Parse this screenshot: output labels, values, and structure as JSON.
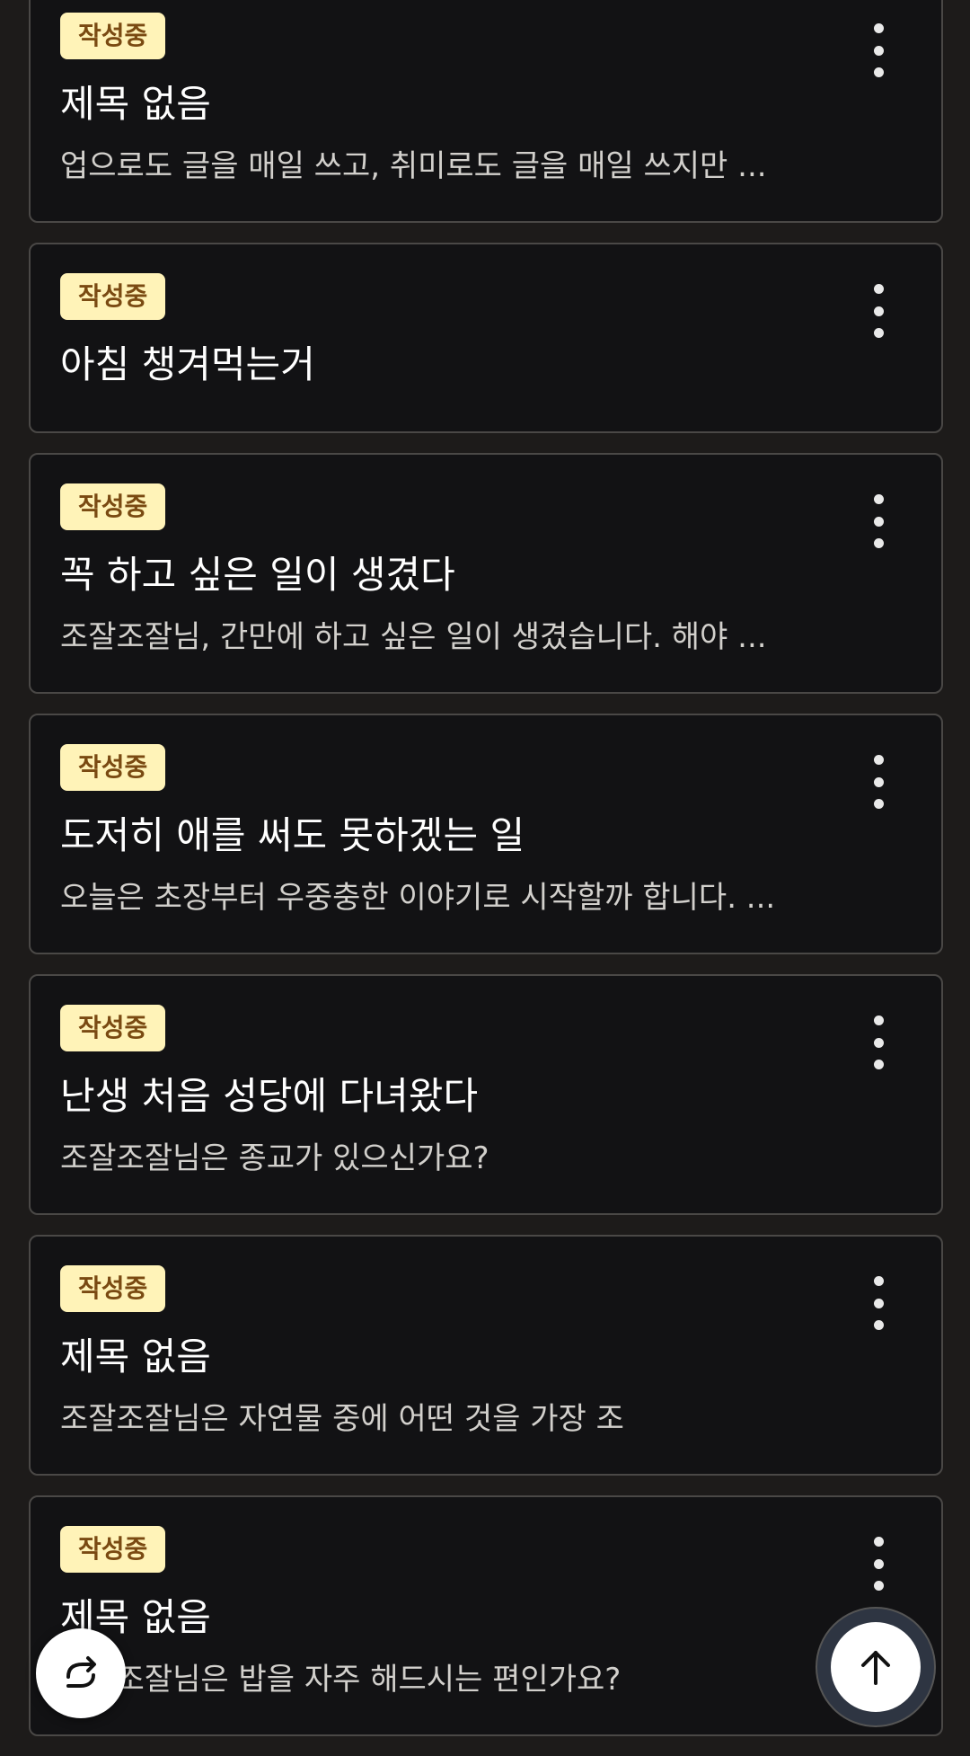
{
  "status_badge": "작성중",
  "drafts": [
    {
      "title": "제목 없음",
      "excerpt": "업으로도 글을 매일 쓰고, 취미로도 글을 매일 쓰지만 ..."
    },
    {
      "title": "아침 챙겨먹는거",
      "excerpt": ""
    },
    {
      "title": "꼭 하고 싶은 일이 생겼다",
      "excerpt": "조잘조잘님, 간만에 하고 싶은 일이 생겼습니다. 해야 ..."
    },
    {
      "title": "도저히 애를 써도 못하겠는 일",
      "excerpt": "오늘은 초장부터 우중충한 이야기로 시작할까 합니다. ..."
    },
    {
      "title": "난생 처음 성당에 다녀왔다",
      "excerpt": "조잘조잘님은 종교가 있으신가요?"
    },
    {
      "title": "제목 없음",
      "excerpt": "조잘조잘님은 자연물 중에 어떤 것을 가장 조"
    },
    {
      "title": "제목 없음",
      "excerpt": "조잘조잘님은 밥을 자주 해드시는 편인가요?"
    }
  ],
  "icons": {
    "more": "more-vertical-icon",
    "share": "share-forward-icon",
    "scroll_top": "arrow-up-icon"
  },
  "colors": {
    "background": "#1d1b1a",
    "card": "#121214",
    "card_border": "#4a4846",
    "badge_bg": "#fff3b8",
    "badge_text": "#7a4a12"
  }
}
